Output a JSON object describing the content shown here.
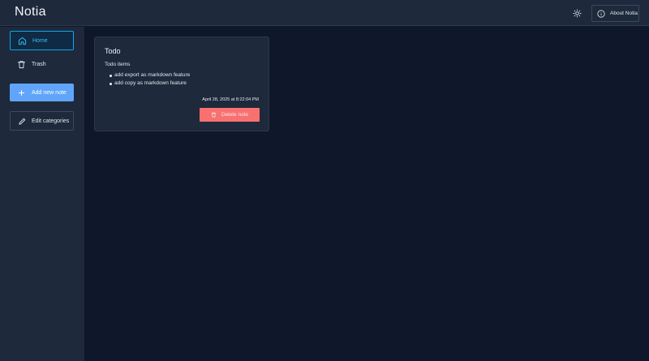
{
  "header": {
    "app_title": "Notia",
    "about_label": "About Notia"
  },
  "sidebar": {
    "items": [
      {
        "label": "Home",
        "icon": "home-icon"
      },
      {
        "label": "Trash",
        "icon": "trash-icon"
      }
    ],
    "add_note_label": "Add new note",
    "edit_categories_label": "Edit categories"
  },
  "note": {
    "title": "Todo",
    "heading": "Todo items",
    "items": [
      "add export as markdown feature",
      "add copy as markdown feature"
    ],
    "date": "April 28, 2025 at 8:22:04 PM",
    "delete_label": "Delete note"
  },
  "colors": {
    "background": "#0f172a",
    "panel": "#1e293b",
    "accent": "#38bdf8",
    "primary_button": "#60a5fa",
    "danger": "#f87171"
  }
}
